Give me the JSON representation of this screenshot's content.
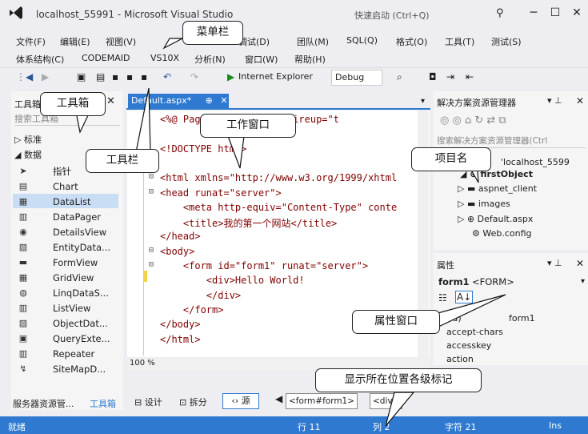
{
  "window": {
    "title": "localhost_55991 - Microsoft Visual Studio",
    "quick_launch": "快速启动 (Ctrl+Q)",
    "minimize": "─",
    "maximize": "☐",
    "close": "✕"
  },
  "menu": {
    "row1": [
      "文件(F)",
      "编辑(E)",
      "视图(V)",
      "调试(D)",
      "团队(M)",
      "SQL(Q)",
      "格式(O)",
      "工具(T)",
      "测试(S)"
    ],
    "row2": [
      "体系结构(C)",
      "CODEMAID",
      "VS10X",
      "分析(N)",
      "窗口(W)",
      "帮助(H)"
    ]
  },
  "toolbar": {
    "browser": "Internet Explorer",
    "config": "Debug"
  },
  "toolbox": {
    "title": "工具箱",
    "search_placeholder": "搜索工具箱",
    "group_standard": "标准",
    "group_data": "数据",
    "items": [
      "指针",
      "Chart",
      "DataList",
      "DataPager",
      "DetailsView",
      "EntityData...",
      "FormView",
      "GridView",
      "LinqDataS...",
      "ListView",
      "ObjectDat...",
      "QueryExte...",
      "Repeater",
      "SiteMapD..."
    ],
    "bottom_tabs": [
      "服务器资源管...",
      "工具箱"
    ]
  },
  "editor": {
    "tab": "Default.aspx*",
    "pin": "⊞",
    "close": "✕",
    "zoom": "100 %",
    "view_buttons": [
      "设计",
      "拆分",
      "源"
    ],
    "breadcrumb": [
      "<form#form1>",
      "<div>"
    ],
    "lines": [
      "<%@ Page ... AutoEventWireup=\"t",
      "",
      "<!DOCTYPE html>",
      "",
      "<html xmlns=\"http://www.w3.org/1999/xhtml",
      "<head runat=\"server\">",
      "    <meta http-equiv=\"Content-Type\" conte",
      "    <title>我的第一个网站</title>",
      "</head>",
      "<body>",
      "    <form id=\"form1\" runat=\"server\">",
      "        <div>Hello World!",
      "        </div>",
      "    </form>",
      "</body>",
      "</html>"
    ]
  },
  "solution": {
    "title": "解决方案资源管理器",
    "search_placeholder": "搜索解决方案资源管理器(Ctrl",
    "project": "'localhost_5599",
    "nodes": [
      "aspnet_client",
      "images",
      "Default.aspx",
      "Web.config"
    ]
  },
  "properties": {
    "title": "属性",
    "object": "form1",
    "object_type": "<FORM>",
    "rows": [
      {
        "name": "(id)",
        "value": "form1"
      },
      {
        "name": "accept-chars",
        "value": ""
      },
      {
        "name": "accesskey",
        "value": ""
      },
      {
        "name": "action",
        "value": ""
      }
    ]
  },
  "status": {
    "ready": "就绪",
    "line": "行 11",
    "col": "列 2",
    "char": "字符 21",
    "mode": "Ins"
  },
  "callouts": {
    "menubar": "菜单栏",
    "toolbox": "工具箱",
    "toolbar": "工具栏",
    "workwindow": "工作窗口",
    "project": "项目名",
    "properties": "属性窗口",
    "tags": "显示所在位置各级标记"
  },
  "colors": {
    "accent": "#2f7ad0",
    "background": "#eeeef2"
  }
}
